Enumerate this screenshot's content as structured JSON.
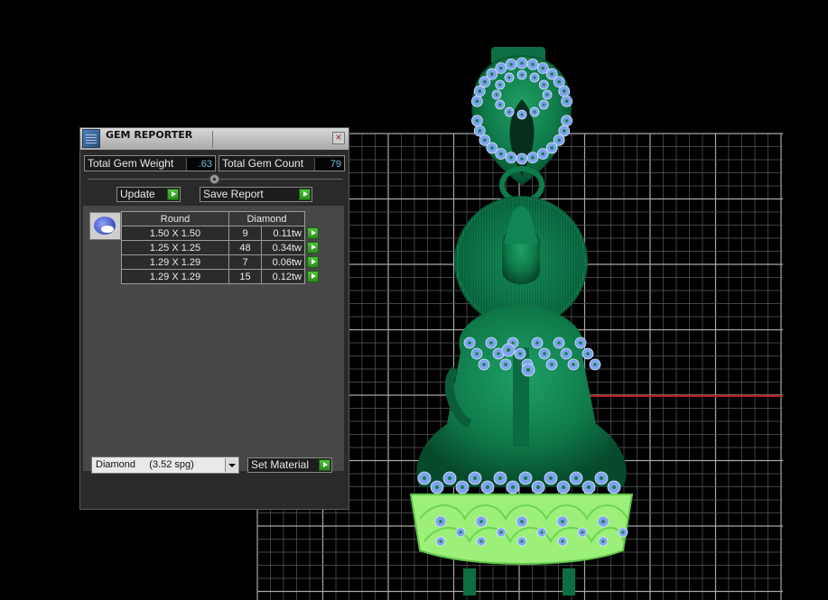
{
  "window": {
    "title": "GEM REPORTER",
    "close_label": "×"
  },
  "summary": {
    "total_weight_label": "Total Gem Weight",
    "total_weight_value": ".63",
    "total_count_label": "Total Gem Count",
    "total_count_value": "79"
  },
  "toolbar": {
    "update_label": "Update",
    "save_report_label": "Save Report"
  },
  "table": {
    "shape_header": "Round",
    "material_header": "Diamond",
    "rows": [
      {
        "size": "1.50 X 1.50",
        "count": "9",
        "weight": "0.11tw"
      },
      {
        "size": "1.25 X 1.25",
        "count": "48",
        "weight": "0.34tw"
      },
      {
        "size": "1.29 X 1.29",
        "count": "7",
        "weight": "0.06tw"
      },
      {
        "size": "1.29 X 1.29",
        "count": "15",
        "weight": "0.12tw"
      }
    ]
  },
  "material": {
    "selected": "Diamond     (3.52 spg)",
    "set_label": "Set Material"
  },
  "colors": {
    "model_green": "#0f7a4a",
    "gem_blue": "#7da4ec",
    "mount_green": "#9cf07a",
    "grid": "#8a8a8a",
    "axis_red": "#c01818",
    "play_green": "#3aa82a"
  },
  "icons": {
    "app": "gem-reporter-icon",
    "close": "close-icon",
    "gem": "round-gem-icon",
    "run": "play-arrow-icon",
    "dropdown": "chevron-down-icon"
  }
}
